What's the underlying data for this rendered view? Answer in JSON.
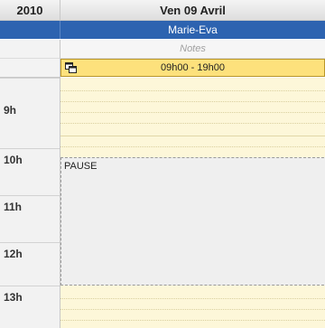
{
  "header": {
    "year": "2010",
    "day": "Ven 09 Avril"
  },
  "resource": {
    "name": "Marie-Eva"
  },
  "notes": {
    "placeholder": "Notes"
  },
  "shift": {
    "range": "09h00 - 19h00",
    "icon": "copy-icon"
  },
  "hours": [
    "9h",
    "10h",
    "11h",
    "12h",
    "13h"
  ],
  "pause": {
    "label": "PAUSE"
  },
  "colors": {
    "resource_bar": "#2d63b0",
    "shift_bar": "#fde17c",
    "work_band": "#fdf7d9",
    "pause_band": "#efefef"
  }
}
